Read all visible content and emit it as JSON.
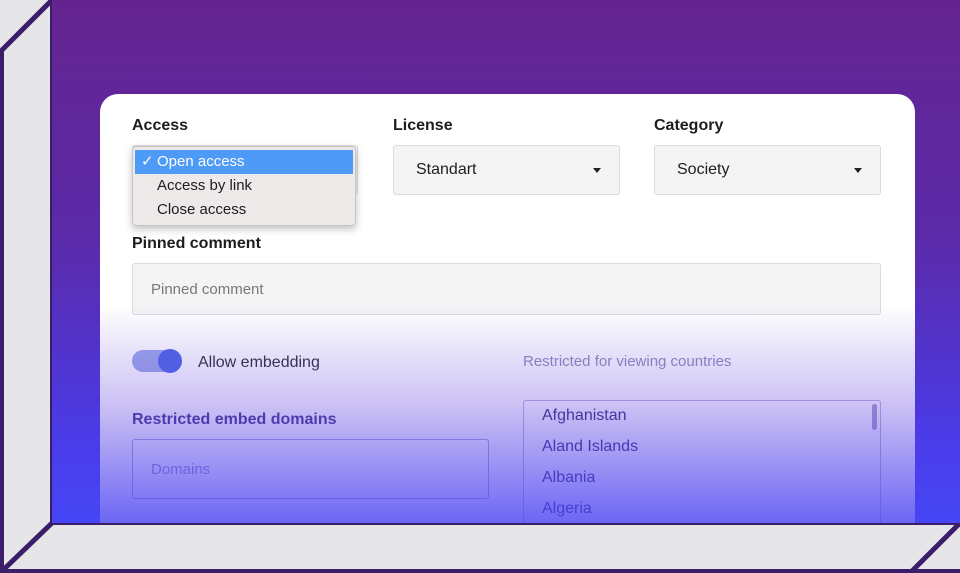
{
  "access": {
    "label": "Access",
    "options": [
      "Open access",
      "Access by link",
      "Close access"
    ],
    "selected_index": 0,
    "check_glyph": "✓"
  },
  "license": {
    "label": "License",
    "value": "Standart"
  },
  "category": {
    "label": "Category",
    "value": "Society"
  },
  "pinned_comment": {
    "label": "Pinned comment",
    "placeholder": "Pinned comment"
  },
  "embedding": {
    "label": "Allow embedding",
    "enabled": true
  },
  "restricted_embed_domains": {
    "label": "Restricted embed domains",
    "placeholder": "Domains"
  },
  "restricted_countries": {
    "label": "Restricted for viewing countries",
    "items": [
      "Afghanistan",
      "Aland Islands",
      "Albania",
      "Algeria"
    ]
  },
  "colors": {
    "accent": "#4a63e6",
    "selection": "#4d9bf7",
    "bg_top": "#64248f",
    "bg_bottom": "#4646f5"
  }
}
